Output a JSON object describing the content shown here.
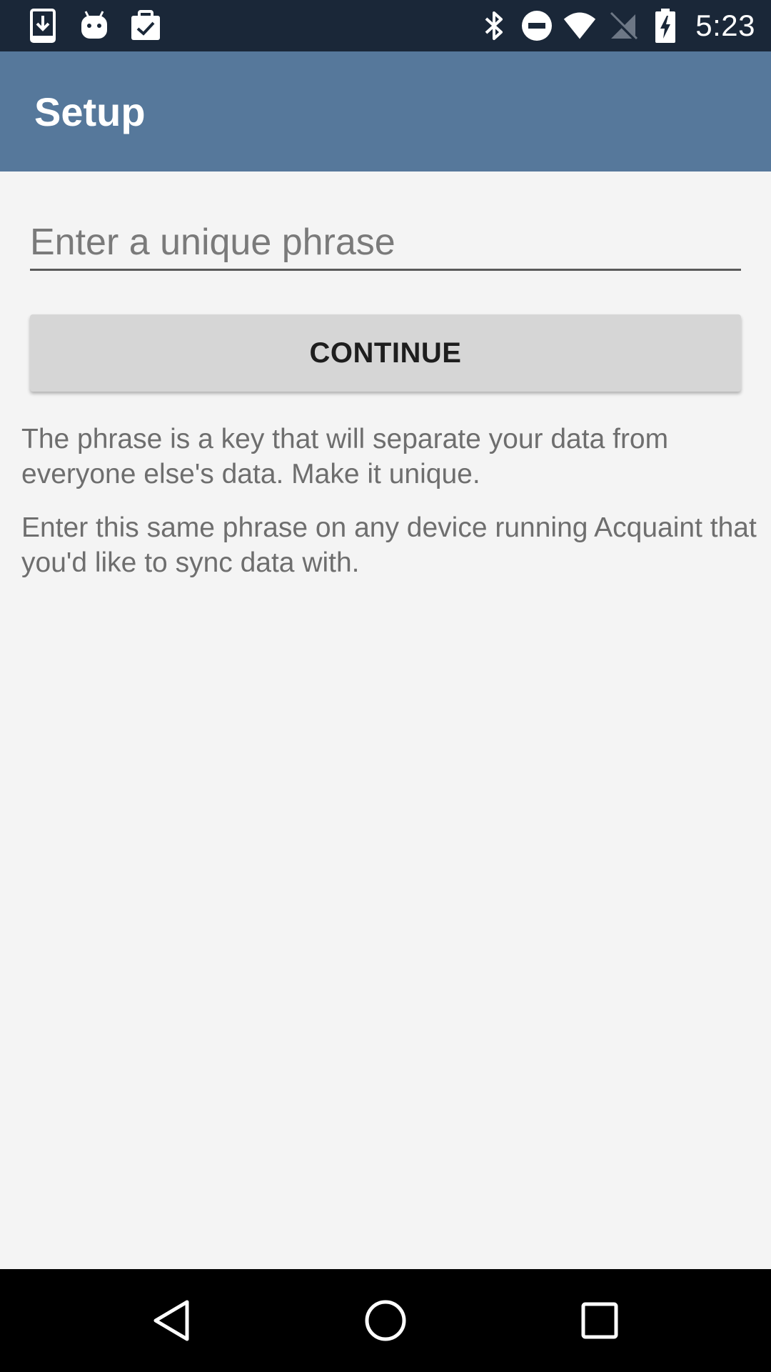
{
  "status_bar": {
    "time": "5:23",
    "left_icons": [
      "download-icon",
      "android-icon",
      "clipboard-check-icon"
    ],
    "right_icons": [
      "bluetooth-icon",
      "do-not-disturb-icon",
      "wifi-icon",
      "no-sim-icon",
      "battery-charging-icon"
    ]
  },
  "app_bar": {
    "title": "Setup",
    "color": "#56789b"
  },
  "form": {
    "phrase_input": {
      "placeholder": "Enter a unique phrase",
      "value": ""
    },
    "continue_label": "CONTINUE"
  },
  "help": {
    "paragraph_1": "The phrase is a key that will separate your data from everyone else's data. Make it unique.",
    "paragraph_2": "Enter this same phrase on any device running Acquaint that you'd like to sync data with."
  },
  "nav_bar": {
    "buttons": [
      "back-icon",
      "home-icon",
      "recents-icon"
    ]
  }
}
